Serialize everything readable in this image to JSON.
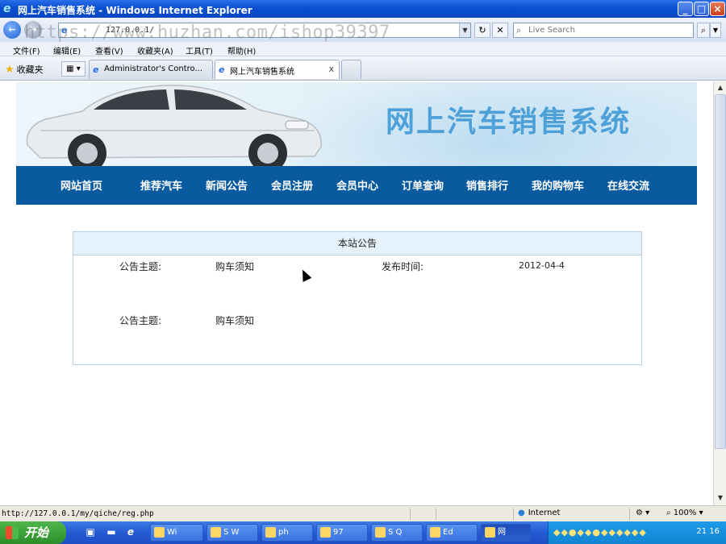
{
  "window": {
    "title": "网上汽车销售系统 - Windows Internet Explorer"
  },
  "address": {
    "url": "127.0.0.1/",
    "search_placeholder": "Live Search",
    "watermark": "https://www.huzhan.com/ishop39397"
  },
  "menu": [
    "文件(F)",
    "编辑(E)",
    "查看(V)",
    "收藏夹(A)",
    "工具(T)",
    "帮助(H)"
  ],
  "favorites": {
    "label": "收藏夹"
  },
  "tabs": [
    {
      "label": "Administrator's Contro..."
    },
    {
      "label": "网上汽车销售系统",
      "close": "x"
    }
  ],
  "site": {
    "name": "网上汽车销售系统",
    "nav": [
      "网站首页",
      "推荐汽车",
      "新闻公告",
      "会员注册",
      "会员中心",
      "订单查询",
      "销售排行",
      "我的购物车",
      "在线交流"
    ]
  },
  "notice": {
    "heading": "本站公告",
    "rows": [
      {
        "subject_label": "公告主题:",
        "subject": "购车须知",
        "time_label": "发布时间:",
        "time": "2012-04-4"
      },
      {
        "subject_label": "公告主题:",
        "subject": "购车须知"
      }
    ]
  },
  "status": {
    "text": "http://127.0.0.1/my/qiche/reg.php",
    "zone": "Internet",
    "zoom": "100%"
  },
  "taskbar": {
    "start": "开始",
    "buttons": [
      "Wi",
      "S W",
      "ph",
      "97",
      "S Q",
      "Ed",
      "网"
    ],
    "clock": "21 16"
  }
}
